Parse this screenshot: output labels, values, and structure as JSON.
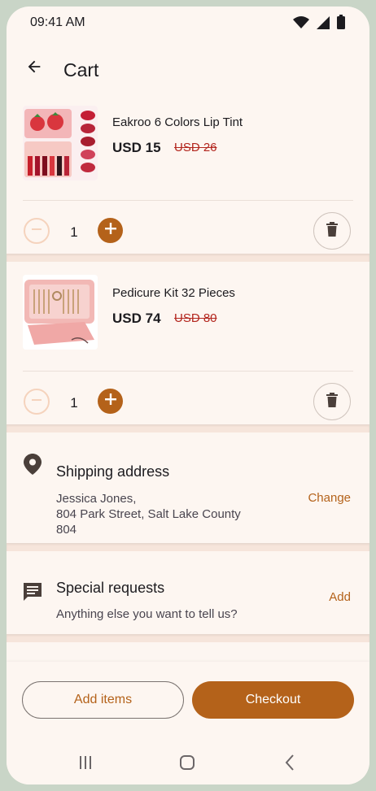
{
  "status_bar": {
    "time": "09:41 AM",
    "icons": [
      "wifi-icon",
      "signal-icon",
      "battery-icon"
    ]
  },
  "header": {
    "title": "Cart",
    "back_icon": "arrow-back-icon"
  },
  "cart_items": [
    {
      "name": "Eakroo 6 Colors Lip Tint",
      "price": "USD 15",
      "original_price": "USD 26",
      "quantity": "1"
    },
    {
      "name": "Pedicure Kit 32 Pieces",
      "price": "USD 74",
      "original_price": "USD 80",
      "quantity": "1"
    }
  ],
  "shipping": {
    "title": "Shipping address",
    "name": "Jessica Jones,",
    "address_line": "804 Park Street, Salt Lake County",
    "address_line2": "804",
    "action": "Change"
  },
  "special_requests": {
    "title": "Special requests",
    "subtitle": "Anything else you want to tell us?",
    "action": "Add"
  },
  "actions": {
    "add_items": "Add items",
    "checkout": "Checkout"
  },
  "colors": {
    "accent": "#b4621a",
    "background": "#fdf6f1",
    "strike_price": "#b3261e",
    "outer_frame": "#c9d5c7"
  }
}
